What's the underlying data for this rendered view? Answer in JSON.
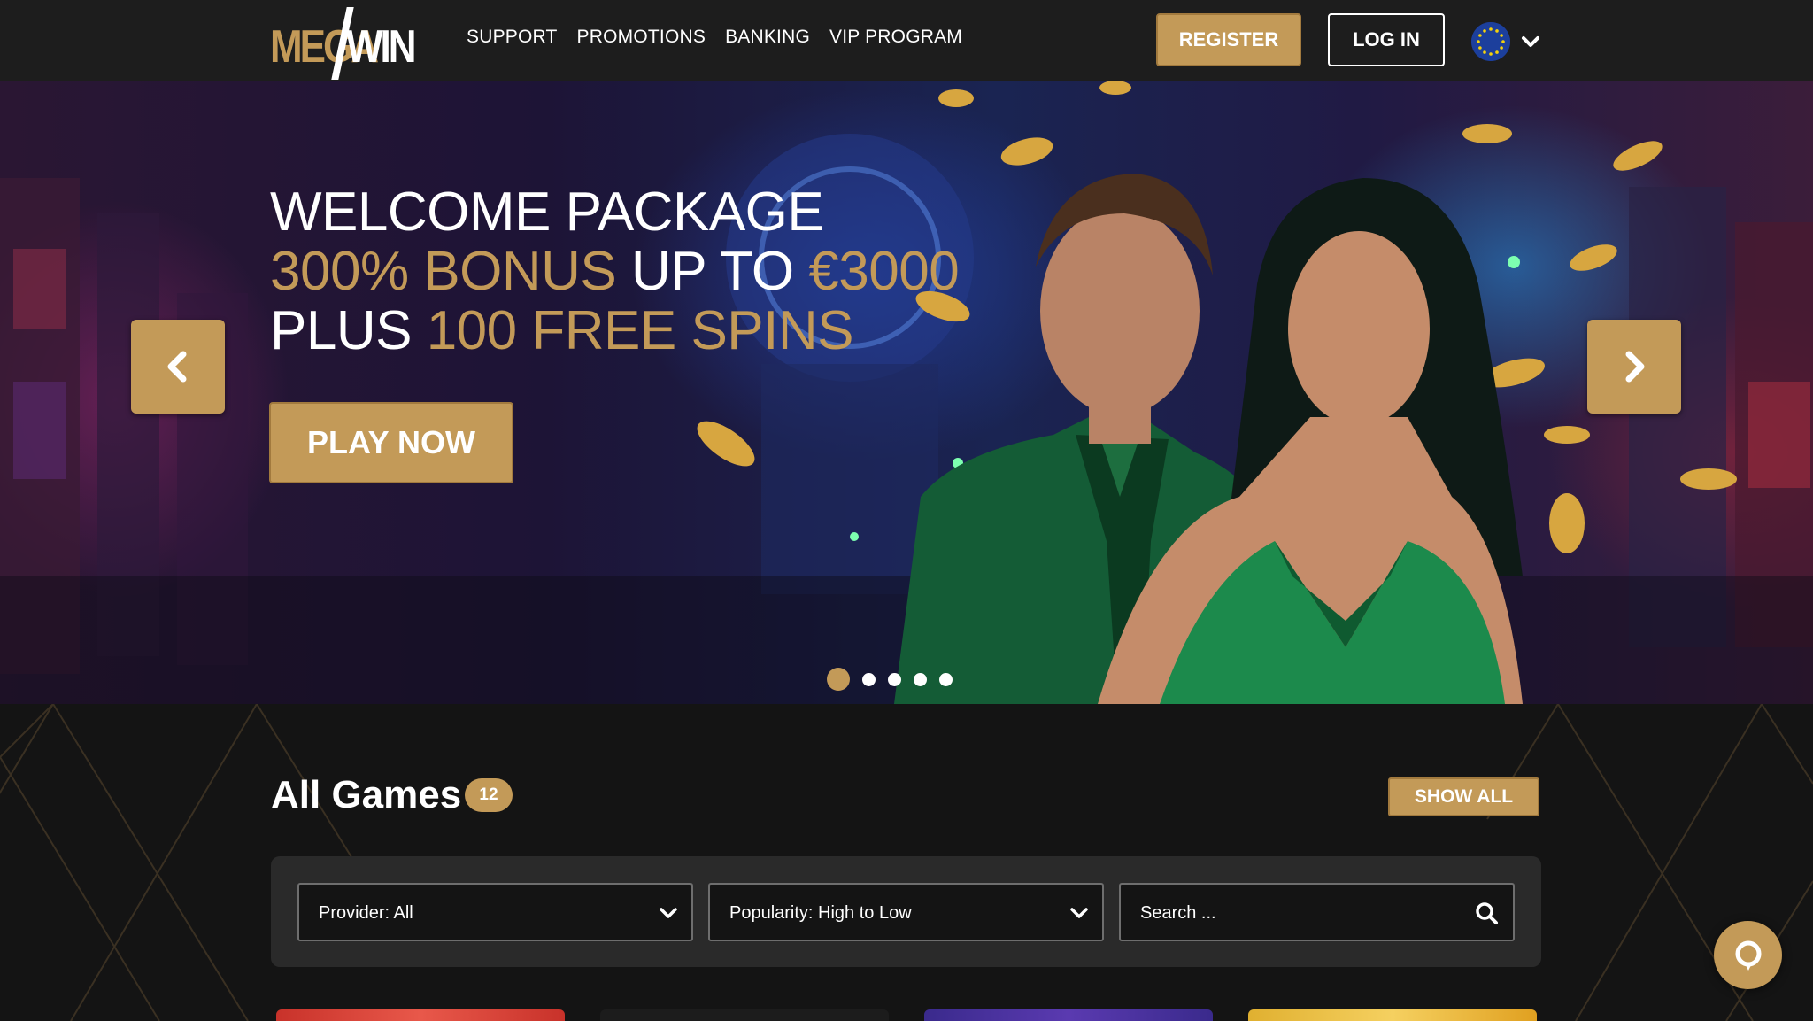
{
  "brand": {
    "logo_left": "MEGA",
    "logo_right": "WIN"
  },
  "nav": {
    "items": [
      {
        "label": "SUPPORT"
      },
      {
        "label": "PROMOTIONS"
      },
      {
        "label": "BANKING"
      },
      {
        "label": "VIP PROGRAM"
      }
    ]
  },
  "header": {
    "register_label": "REGISTER",
    "login_label": "LOG IN",
    "language_icon": "eu-flag-icon"
  },
  "hero": {
    "line1": "WELCOME PACKAGE",
    "line2_gold_a": "300% BONUS",
    "line2_white": " UP TO ",
    "line2_gold_b": "€3000",
    "line3_white": "PLUS ",
    "line3_gold": "100 FREE SPINS",
    "cta_label": "PLAY NOW",
    "slides_total": 5,
    "active_slide": 1
  },
  "games": {
    "title": "All Games",
    "count": "12",
    "show_all_label": "SHOW ALL",
    "provider_filter": "Provider: All",
    "sort_filter": "Popularity: High to Low",
    "search_placeholder": "Search ..."
  },
  "colors": {
    "accent": "#c39a58",
    "header_bg": "#1d1d1d",
    "page_bg": "#141414",
    "panel_bg": "#2a2a2a"
  }
}
